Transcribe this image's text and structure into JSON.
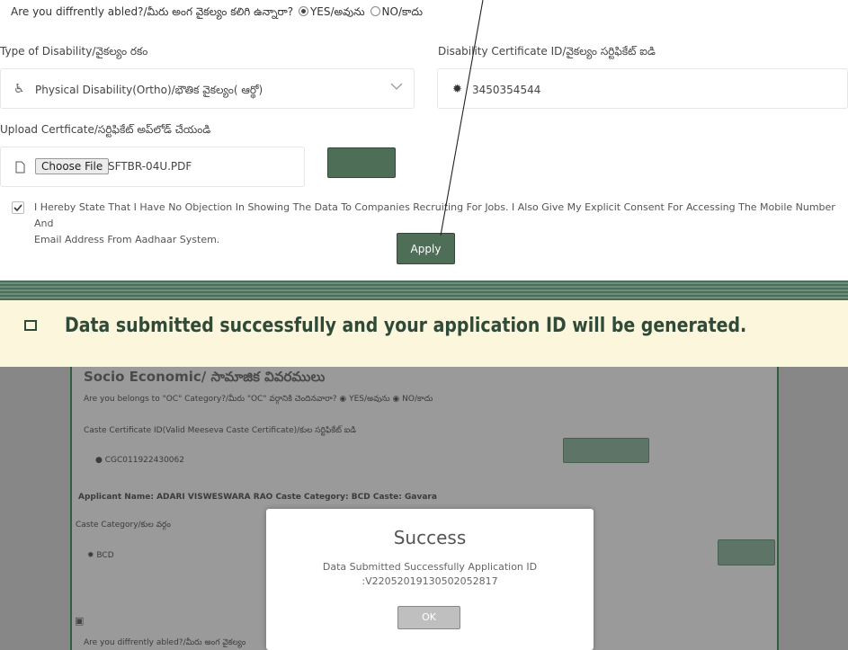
{
  "form": {
    "disability_question": "Are you diffrently abled?/మీరు అంగ వైకల్యం కలిగి ఉన్నారా?",
    "yes_label": "YES/అవును",
    "no_label": "NO/కాదు",
    "type_label": "Type of Disability/వైకల్యం రకం",
    "type_value": "Physical Disability(Ortho)/భౌతిక వైకల్యం( ఆర్థో)",
    "cert_id_label": "Disability Certificate ID/వైకల్యం సర్టిఫికేట్ ఐడి",
    "cert_id_value": "3450354544",
    "upload_label": "Upload Certficate/సర్టిఫికేట్ అప్‌లోడ్ చేయండి",
    "choose_file": "Choose File",
    "file_name": "SFTBR-04U.PDF",
    "consent_line1": "I Hereby State That I Have No Objection In Showing The Data To Companies Recruiting For Jobs. I Also Give My Explicit Consent For Accessing The Mobile Number And",
    "consent_line2": "Email Address From Aadhaar System.",
    "apply": "Apply"
  },
  "banner": {
    "text": "Data submitted successfully and your application ID will be generated."
  },
  "background_page": {
    "section_title": "Socio Economic/ సామాజిక వివరములు",
    "oc_question": "Are you belongs to \"OC\" Category?/మీరు \"OC\" వర్గానికి చెందినవారా? ◉ YES/అవును ◉ NO/కాదు",
    "caste_cert_label": "Caste Certificate ID(Valid Meeseva Caste Certificate)/కుల సర్టిఫికేట్ ఐడి",
    "caste_cert_value": "CGC011922430062",
    "applicant_line": "Applicant Name: ADARI VISWESWARA RAO  Caste Category: BCD  Caste: Gavara",
    "caste_category_label": "Caste Category/కుల వర్గం",
    "caste_category_value": "BCD",
    "disabled_question": "Are you diffrently abled?/మీరు అంగ వైకల్యం"
  },
  "modal": {
    "title": "Success",
    "message_line1": "Data Submitted Successfully Application ID",
    "message_line2": ":V22052019130502052817",
    "ok": "OK"
  }
}
